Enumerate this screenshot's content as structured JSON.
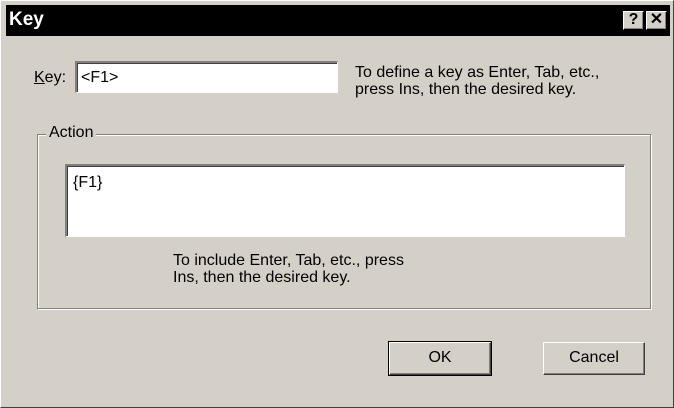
{
  "window": {
    "title": "Key",
    "help_glyph": "?",
    "close_glyph": "✕"
  },
  "key": {
    "label_accel": "K",
    "label_rest": "ey:",
    "value": "<F1>",
    "hint_line1": "To define a key as Enter, Tab, etc.,",
    "hint_line2": "press Ins, then the desired key."
  },
  "action": {
    "legend": "Action",
    "value": "{F1}",
    "hint_line1": "To include Enter, Tab, etc., press",
    "hint_line2": "Ins, then the desired key."
  },
  "buttons": {
    "ok": "OK",
    "cancel": "Cancel"
  }
}
